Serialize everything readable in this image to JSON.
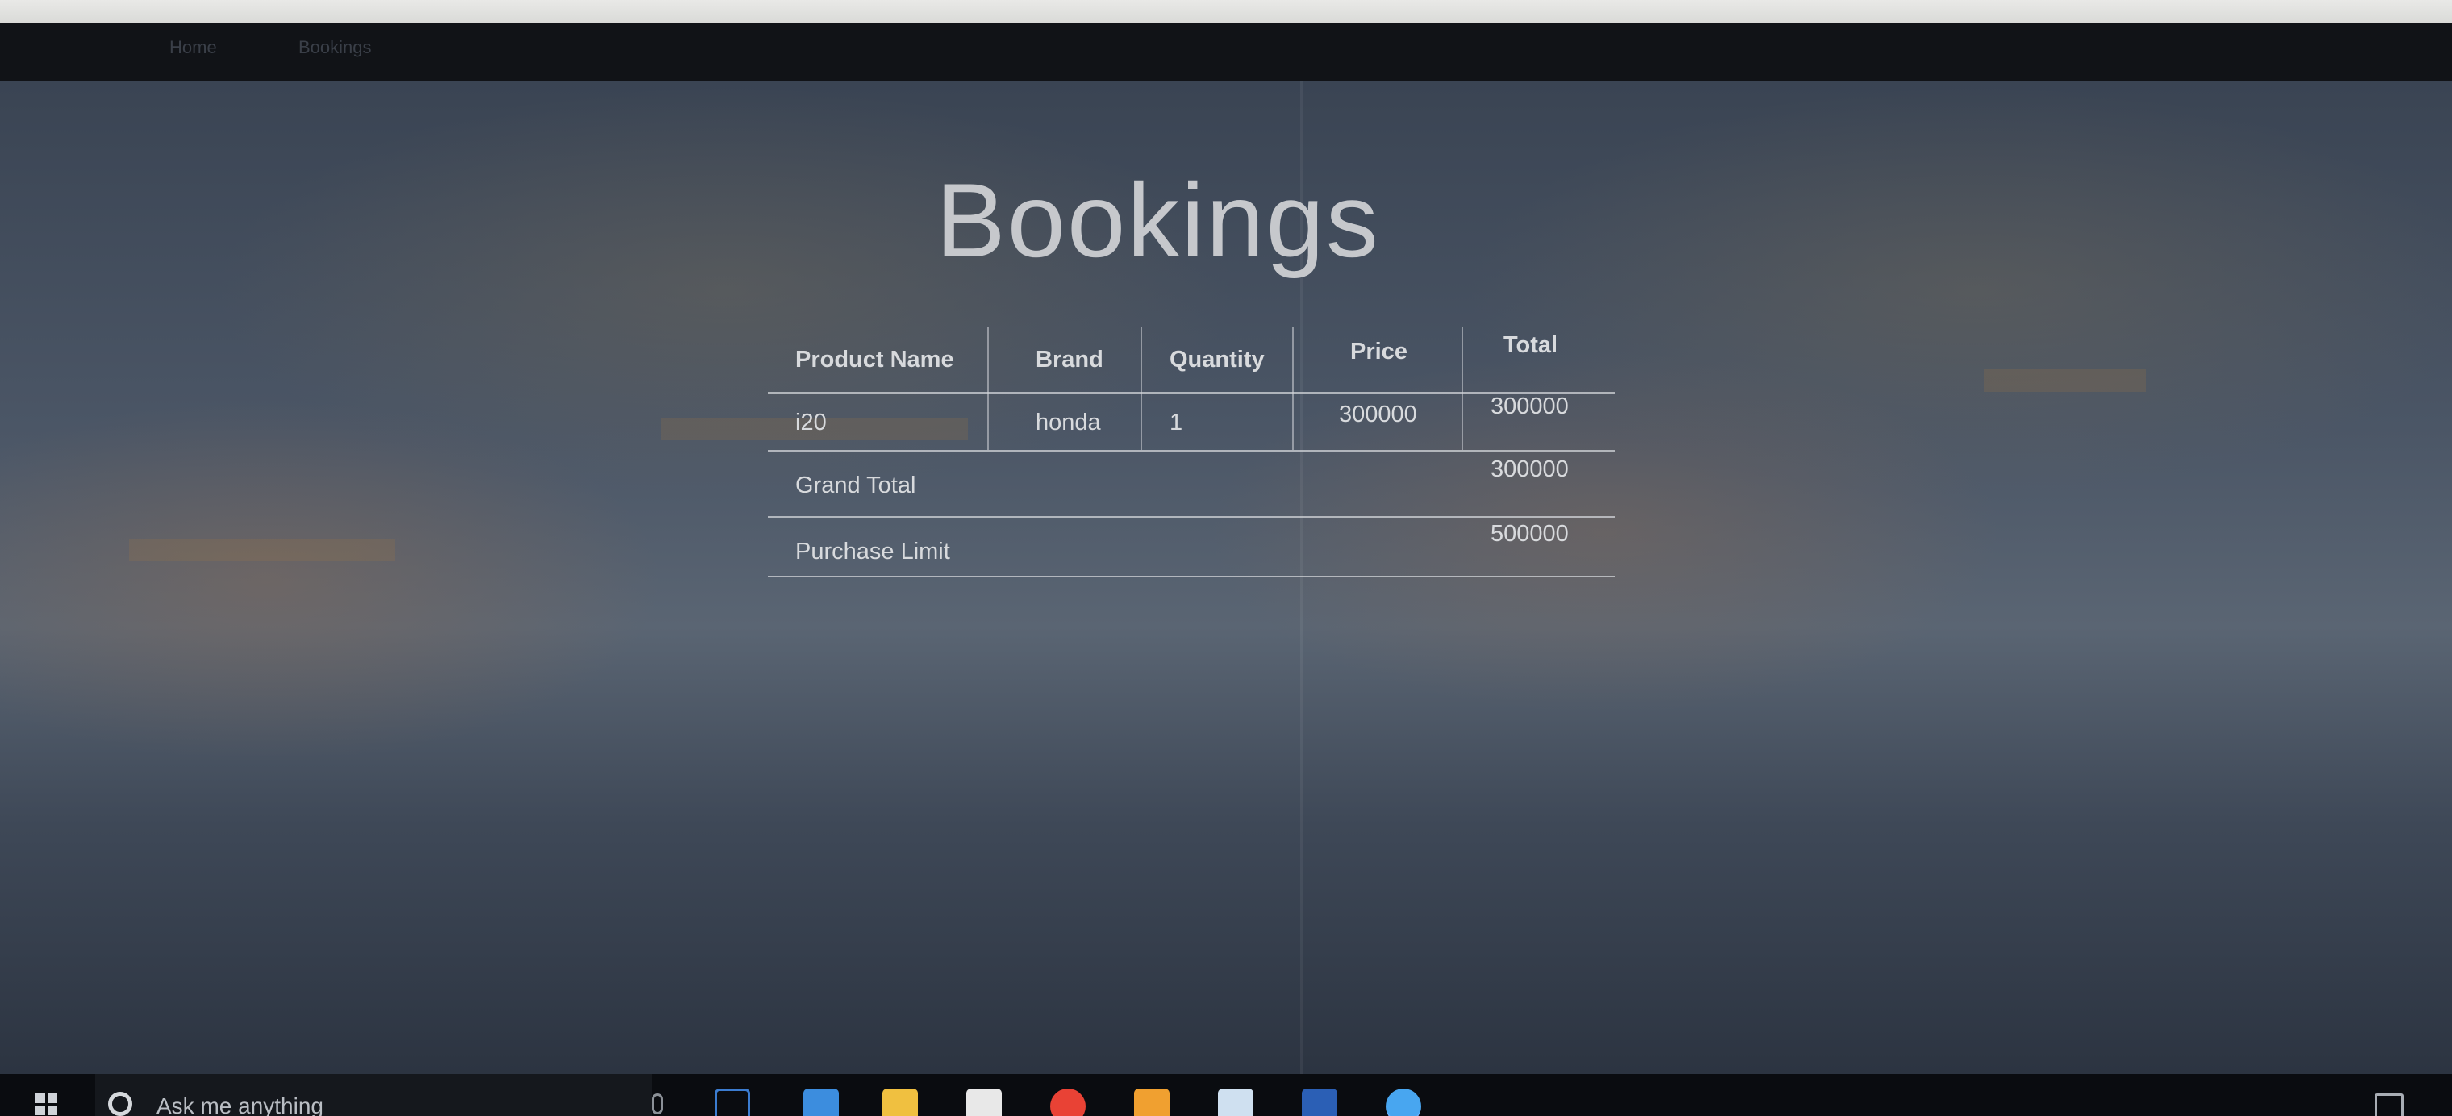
{
  "page": {
    "title": "Bookings"
  },
  "browser": {
    "nav": [
      "Home",
      "Bookings"
    ]
  },
  "table": {
    "headers": [
      "Product Name",
      "Brand",
      "Quantity",
      "Price",
      "Total"
    ],
    "rows": [
      {
        "product": "i20",
        "brand": "honda",
        "quantity": "1",
        "price": "300000",
        "total": "300000"
      }
    ],
    "grand_total_label": "Grand Total",
    "grand_total_value": "300000",
    "purchase_limit_label": "Purchase Limit",
    "purchase_limit_value": "500000"
  },
  "taskbar": {
    "search_placeholder": "Ask me anything",
    "apps": [
      "task-view-icon",
      "edge-icon",
      "file-explorer-icon",
      "store-icon",
      "chrome-icon",
      "paint-icon",
      "app-icon",
      "word-icon",
      "internet-explorer-icon"
    ],
    "colors": {
      "edge": "#3c8dde",
      "explorer": "#f0c040",
      "store": "#ffffff",
      "chrome": "#e94235",
      "paint": "#f0a030",
      "word": "#2b5fb5",
      "ie": "#48a6f0"
    }
  }
}
